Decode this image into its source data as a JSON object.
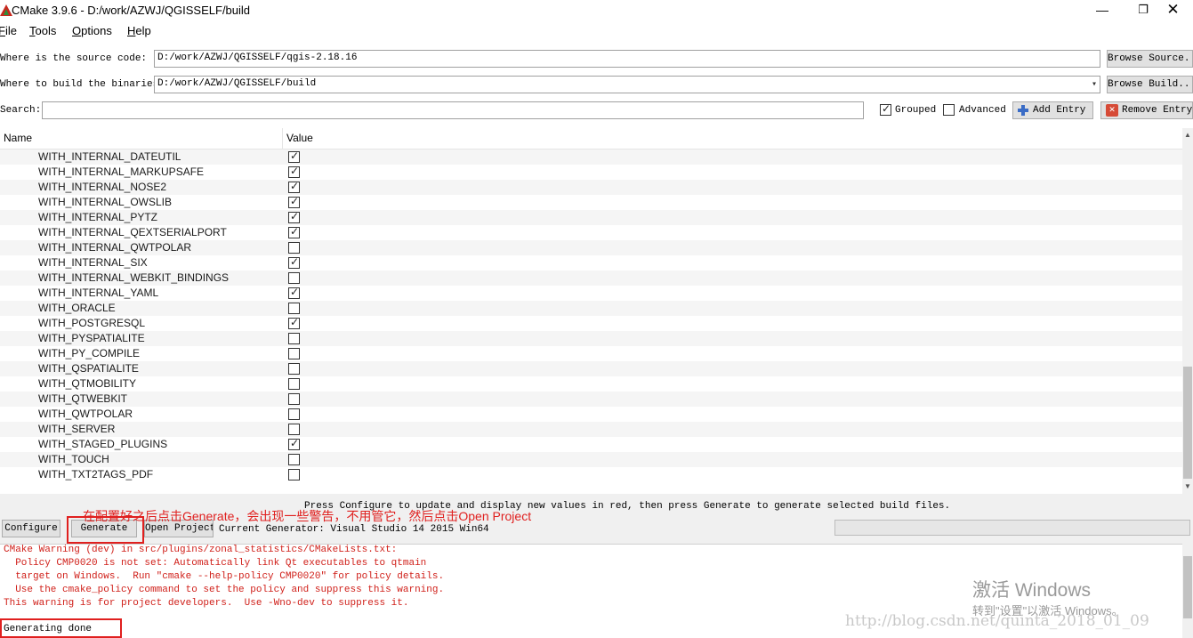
{
  "window": {
    "title": "CMake 3.9.6 - D:/work/AZWJ/QGISSELF/build",
    "controls": {
      "minimize": "—",
      "maximize": "❐",
      "close": "✕"
    }
  },
  "menu": {
    "file": {
      "u": "F",
      "rest": "ile"
    },
    "tools": {
      "u": "T",
      "rest": "ools"
    },
    "options": {
      "u": "O",
      "rest": "ptions"
    },
    "help": {
      "u": "H",
      "rest": "elp"
    }
  },
  "source": {
    "label": "Where is the source code:",
    "value": "D:/work/AZWJ/QGISSELF/qgis-2.18.16",
    "browse_label": "Browse Source..."
  },
  "binaries": {
    "label": "Where to build the binaries:",
    "value": "D:/work/AZWJ/QGISSELF/build",
    "browse_label": "Browse Build..."
  },
  "search": {
    "label": "Search:",
    "value": "",
    "grouped_label": "Grouped",
    "grouped_checked": true,
    "advanced_label": "Advanced",
    "advanced_checked": false,
    "add_entry_label": "Add Entry",
    "remove_entry_label": "Remove Entry"
  },
  "table": {
    "columns": [
      "Name",
      "Value"
    ],
    "rows": [
      {
        "name": "WITH_INTERNAL_DATEUTIL",
        "checked": true
      },
      {
        "name": "WITH_INTERNAL_MARKUPSAFE",
        "checked": true
      },
      {
        "name": "WITH_INTERNAL_NOSE2",
        "checked": true
      },
      {
        "name": "WITH_INTERNAL_OWSLIB",
        "checked": true
      },
      {
        "name": "WITH_INTERNAL_PYTZ",
        "checked": true
      },
      {
        "name": "WITH_INTERNAL_QEXTSERIALPORT",
        "checked": true
      },
      {
        "name": "WITH_INTERNAL_QWTPOLAR",
        "checked": false
      },
      {
        "name": "WITH_INTERNAL_SIX",
        "checked": true
      },
      {
        "name": "WITH_INTERNAL_WEBKIT_BINDINGS",
        "checked": false
      },
      {
        "name": "WITH_INTERNAL_YAML",
        "checked": true
      },
      {
        "name": "WITH_ORACLE",
        "checked": false
      },
      {
        "name": "WITH_POSTGRESQL",
        "checked": true
      },
      {
        "name": "WITH_PYSPATIALITE",
        "checked": false
      },
      {
        "name": "WITH_PY_COMPILE",
        "checked": false
      },
      {
        "name": "WITH_QSPATIALITE",
        "checked": false
      },
      {
        "name": "WITH_QTMOBILITY",
        "checked": false
      },
      {
        "name": "WITH_QTWEBKIT",
        "checked": false
      },
      {
        "name": "WITH_QWTPOLAR",
        "checked": false
      },
      {
        "name": "WITH_SERVER",
        "checked": false
      },
      {
        "name": "WITH_STAGED_PLUGINS",
        "checked": true
      },
      {
        "name": "WITH_TOUCH",
        "checked": false
      },
      {
        "name": "WITH_TXT2TAGS_PDF",
        "checked": false
      }
    ]
  },
  "hint_text": "Press Configure to update and display new values in red, then press Generate to generate selected build files.",
  "annotation": "在配置好之后点击Generate，会出现一些警告，不用管它，然后点击Open Project",
  "actions": {
    "configure": "Configure",
    "generate": "Generate",
    "open_project": "Open Project",
    "generator": "Current Generator: Visual Studio 14 2015 Win64"
  },
  "log": {
    "lines": [
      "CMake Warning (dev) in src/plugins/zonal_statistics/CMakeLists.txt:",
      "  Policy CMP0020 is not set: Automatically link Qt executables to qtmain",
      "  target on Windows.  Run \"cmake --help-policy CMP0020\" for policy details.",
      "  Use the cmake_policy command to set the policy and suppress this warning.",
      "This warning is for project developers.  Use -Wno-dev to suppress it."
    ],
    "done": "Generating done"
  },
  "watermark": {
    "title": "激活 Windows",
    "subtitle": "转到\"设置\"以激活 Windows。",
    "url": "http://blog.csdn.net/quinta_2018_01_09"
  }
}
